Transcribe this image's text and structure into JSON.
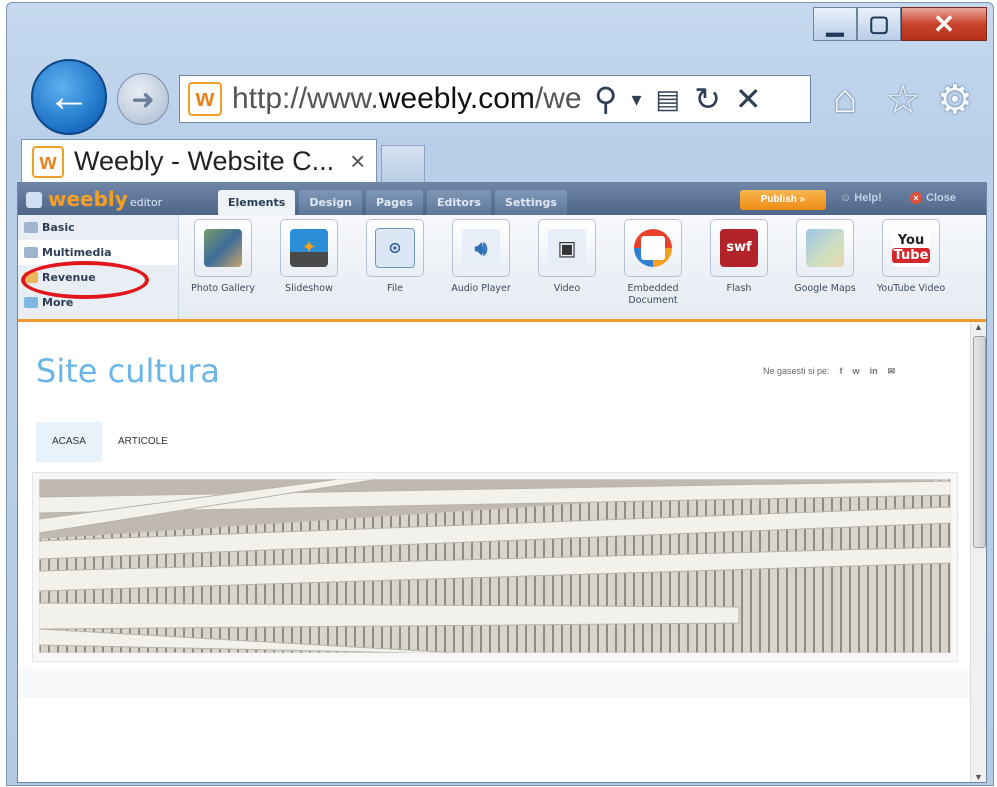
{
  "browser": {
    "url_prefix": "http://www.",
    "url_domain": "weebly.com",
    "url_suffix": "/weet",
    "tab_title": "Weebly - Website C...",
    "tab_close": "×",
    "favicon_letter": "w"
  },
  "editor": {
    "logo": "weebly",
    "logo_sub": "editor",
    "tabs": [
      "Elements",
      "Design",
      "Pages",
      "Editors",
      "Settings"
    ],
    "publish_label": "Publish »",
    "help_label": "Help!",
    "close_label": "Close",
    "categories": [
      "Basic",
      "Multimedia",
      "Revenue",
      "More"
    ],
    "elements": [
      {
        "label": "Photo Gallery",
        "icon": "photo-gallery-icon"
      },
      {
        "label": "Slideshow",
        "icon": "slideshow-icon"
      },
      {
        "label": "File",
        "icon": "file-icon"
      },
      {
        "label": "Audio Player",
        "icon": "audio-player-icon"
      },
      {
        "label": "Video",
        "icon": "video-icon"
      },
      {
        "label": "Embedded Document",
        "icon": "embedded-document-icon"
      },
      {
        "label": "Flash",
        "icon": "flash-icon",
        "text": "swf"
      },
      {
        "label": "Google Maps",
        "icon": "google-maps-icon"
      },
      {
        "label": "YouTube Video",
        "icon": "youtube-icon",
        "text_top": "You",
        "text_bottom": "Tube"
      }
    ]
  },
  "site": {
    "title": "Site cultura",
    "share_label": "Ne gasesti si pe:",
    "share_icons": [
      "f",
      "w",
      "in",
      "✉"
    ],
    "nav": [
      "ACASA",
      "ARTICOLE"
    ]
  },
  "colors": {
    "accent_orange": "#f09a2e",
    "site_title": "#6bb5e8",
    "highlight_ring": "#e1171b"
  }
}
